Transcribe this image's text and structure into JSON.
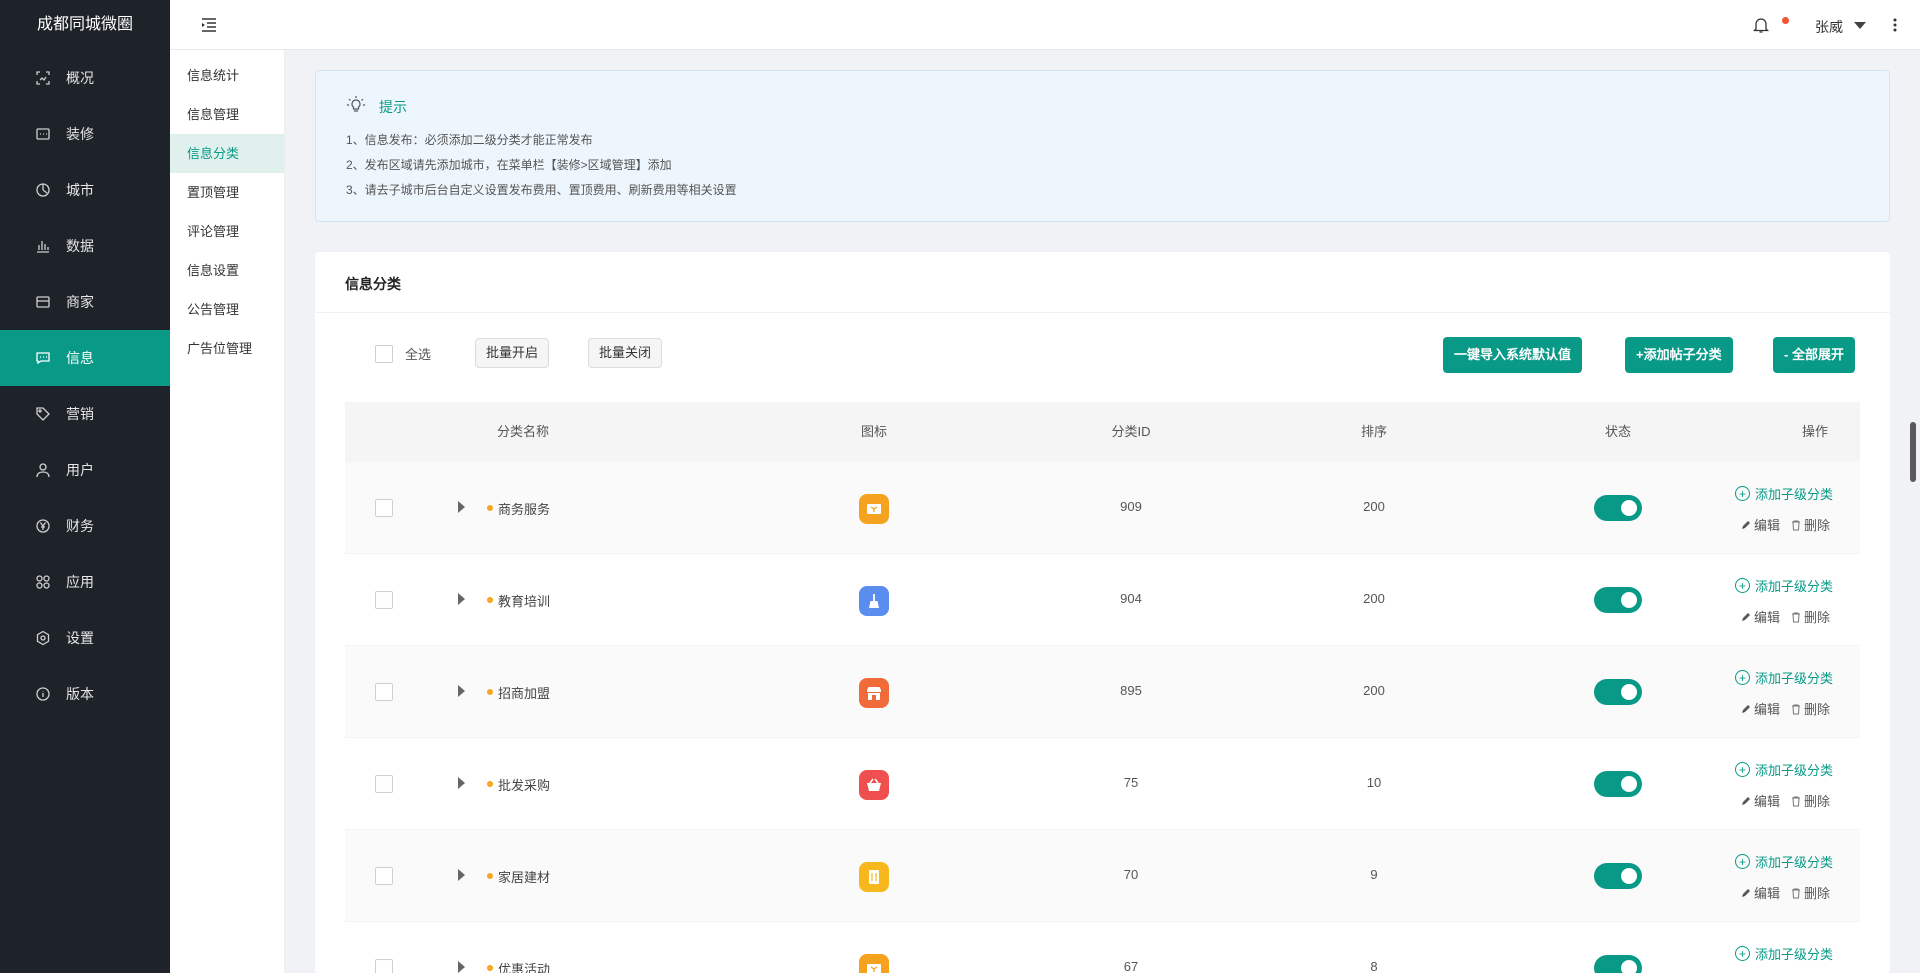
{
  "app": {
    "title": "成都同城微圈"
  },
  "sidebar": {
    "items": [
      {
        "label": "概况",
        "icon": "overview-icon",
        "active": false
      },
      {
        "label": "装修",
        "icon": "decoration-icon",
        "active": false
      },
      {
        "label": "城市",
        "icon": "city-icon",
        "active": false
      },
      {
        "label": "数据",
        "icon": "data-icon",
        "active": false
      },
      {
        "label": "商家",
        "icon": "merchant-icon",
        "active": false
      },
      {
        "label": "信息",
        "icon": "message-icon",
        "active": true
      },
      {
        "label": "营销",
        "icon": "tag-icon",
        "active": false
      },
      {
        "label": "用户",
        "icon": "user-icon",
        "active": false
      },
      {
        "label": "财务",
        "icon": "yen-icon",
        "active": false
      },
      {
        "label": "应用",
        "icon": "apps-icon",
        "active": false
      },
      {
        "label": "设置",
        "icon": "gear-icon",
        "active": false
      },
      {
        "label": "版本",
        "icon": "info-icon",
        "active": false
      }
    ]
  },
  "subnav": {
    "items": [
      {
        "label": "信息统计",
        "active": false
      },
      {
        "label": "信息管理",
        "active": false
      },
      {
        "label": "信息分类",
        "active": true
      },
      {
        "label": "置顶管理",
        "active": false
      },
      {
        "label": "评论管理",
        "active": false
      },
      {
        "label": "信息设置",
        "active": false
      },
      {
        "label": "公告管理",
        "active": false
      },
      {
        "label": "广告位管理",
        "active": false
      }
    ]
  },
  "header": {
    "user_name": "张威"
  },
  "tip": {
    "title": "提示",
    "lines": [
      "1、信息发布：必须添加二级分类才能正常发布",
      "2、发布区域请先添加城市，在菜单栏【装修>区域管理】添加",
      "3、请去子城市后台自定义设置发布费用、置顶费用、刷新费用等相关设置"
    ]
  },
  "card": {
    "title": "信息分类",
    "select_all_label": "全选",
    "batch_open": "批量开启",
    "batch_close": "批量关闭",
    "import_default": "一键导入系统默认值",
    "add_category": "+添加帖子分类",
    "expand_all": "- 全部展开"
  },
  "table": {
    "columns": [
      "分类名称",
      "图标",
      "分类ID",
      "排序",
      "状态",
      "操作"
    ],
    "add_child_label": "添加子级分类",
    "edit_label": "编辑",
    "delete_label": "删除",
    "rows": [
      {
        "name": "商务服务",
        "id": "909",
        "sort": "200",
        "enabled": true,
        "icon_color": "#f5a21e",
        "icon": "ticket-icon"
      },
      {
        "name": "教育培训",
        "id": "904",
        "sort": "200",
        "enabled": true,
        "icon_color": "#5b8def",
        "icon": "broom-icon"
      },
      {
        "name": "招商加盟",
        "id": "895",
        "sort": "200",
        "enabled": true,
        "icon_color": "#f06a3a",
        "icon": "store-icon"
      },
      {
        "name": "批发采购",
        "id": "75",
        "sort": "10",
        "enabled": true,
        "icon_color": "#ef4f4f",
        "icon": "basket-icon"
      },
      {
        "name": "家居建材",
        "id": "70",
        "sort": "9",
        "enabled": true,
        "icon_color": "#f6b81c",
        "icon": "building-icon"
      },
      {
        "name": "优惠活动",
        "id": "67",
        "sort": "8",
        "enabled": true,
        "icon_color": "#f5a21e",
        "icon": "ticket-icon"
      }
    ]
  },
  "colors": {
    "accent": "#089a87",
    "sidebar_bg": "#1e2229"
  }
}
